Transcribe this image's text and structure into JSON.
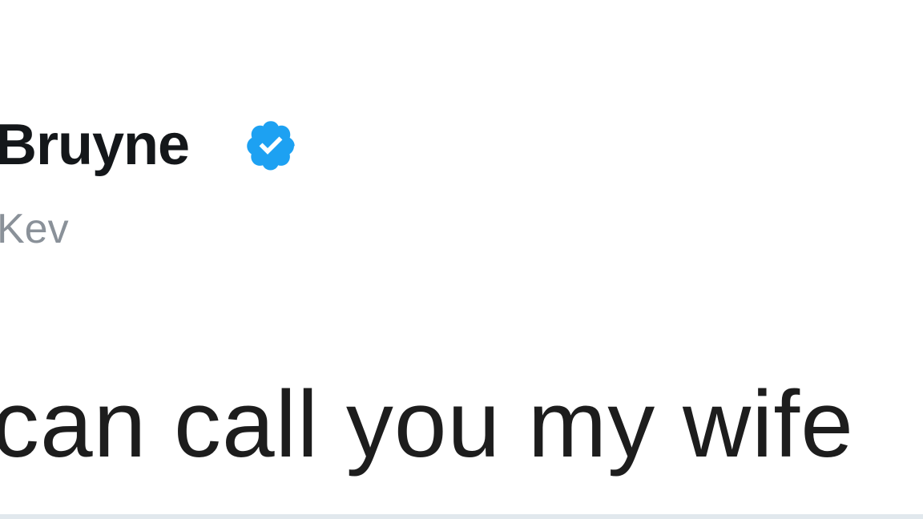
{
  "tweet": {
    "display_name": "Bruyne",
    "verified_icon": "verified-badge-icon",
    "handle": "Kev",
    "text": "can call you my wife",
    "colors": {
      "name": "#14171a",
      "handle": "#8a9199",
      "text": "#1d1d1d",
      "verified": "#1da1f2"
    }
  }
}
